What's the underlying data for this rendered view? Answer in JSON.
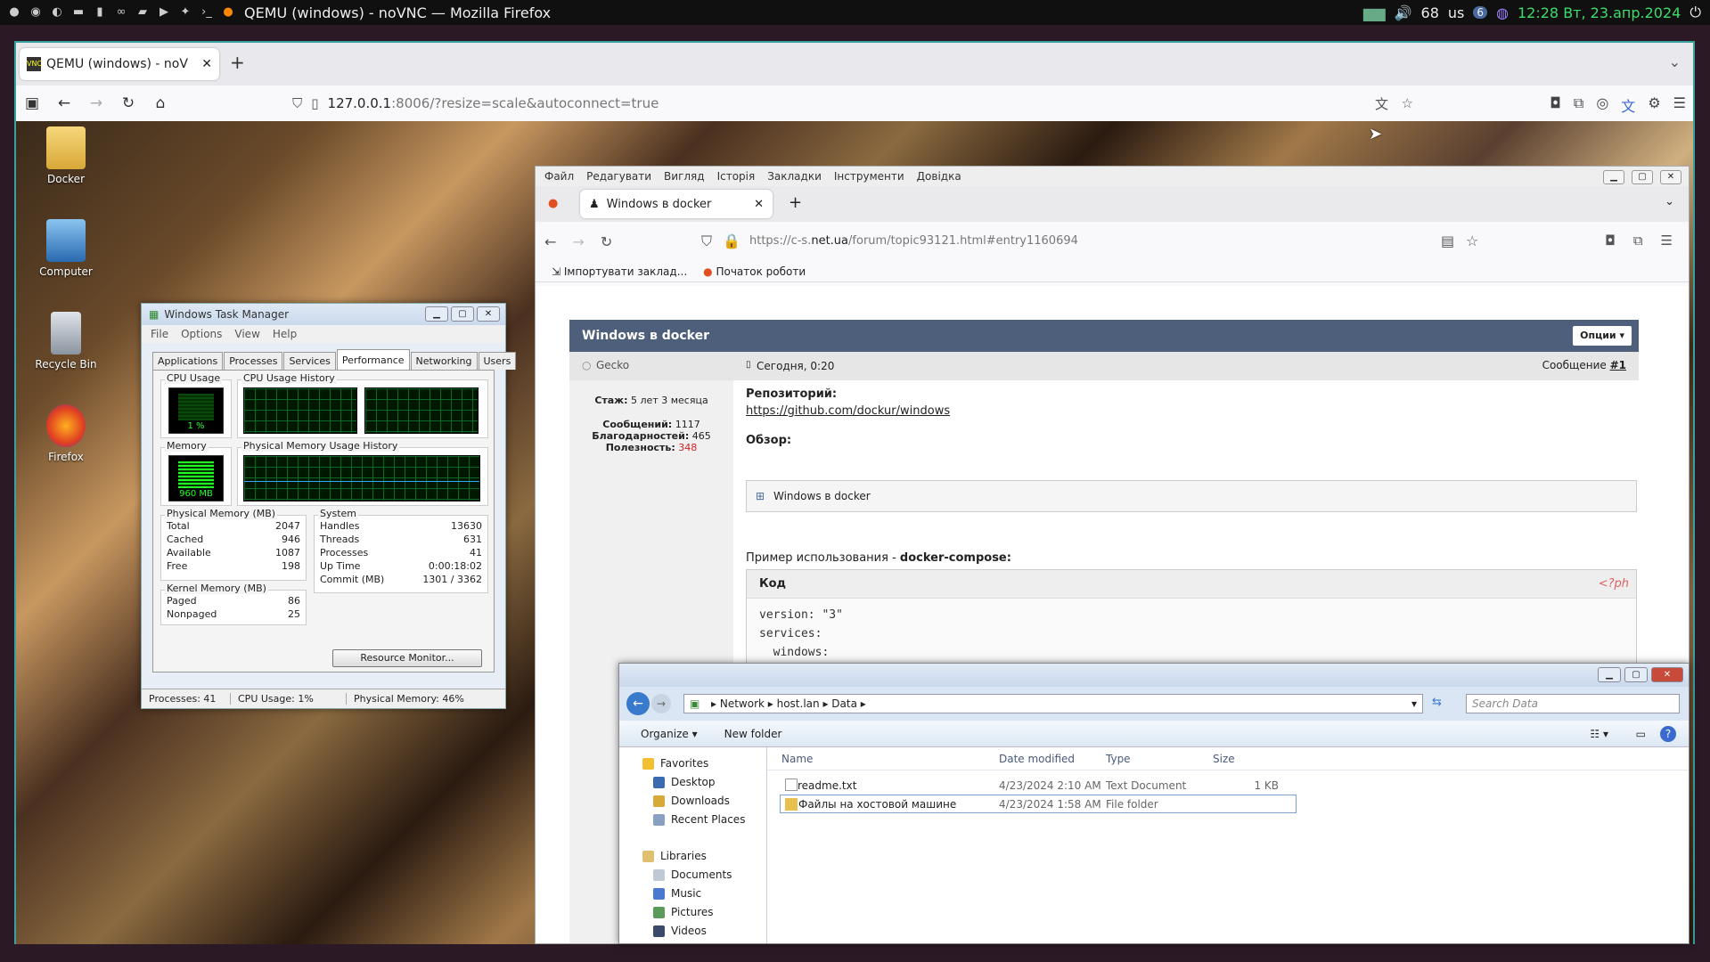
{
  "os_bar": {
    "window_title": "QEMU (windows) - noVNC — Mozilla Firefox",
    "volume": "68",
    "keyboard": "us",
    "badge": "6",
    "clock": "12:28 Вт, 23.апр.2024"
  },
  "outer_browser": {
    "tab_title": "QEMU (windows) - noVNC",
    "url_host": "127.0.0.1",
    "url_rest": ":8006/?resize=scale&autoconnect=true"
  },
  "desktop_icons": [
    "Docker",
    "Computer",
    "Recycle Bin",
    "Firefox"
  ],
  "task_manager": {
    "title": "Windows Task Manager",
    "menu": [
      "File",
      "Options",
      "View",
      "Help"
    ],
    "tabs": [
      "Applications",
      "Processes",
      "Services",
      "Performance",
      "Networking",
      "Users"
    ],
    "active_tab": "Performance",
    "cpu_usage_label": "CPU Usage",
    "cpu_value": "1 %",
    "cpu_history_label": "CPU Usage History",
    "memory_label": "Memory",
    "memory_value": "960 MB",
    "memory_history_label": "Physical Memory Usage History",
    "physical_memory": {
      "title": "Physical Memory (MB)",
      "rows": [
        [
          "Total",
          "2047"
        ],
        [
          "Cached",
          "946"
        ],
        [
          "Available",
          "1087"
        ],
        [
          "Free",
          "198"
        ]
      ]
    },
    "system": {
      "title": "System",
      "rows": [
        [
          "Handles",
          "13630"
        ],
        [
          "Threads",
          "631"
        ],
        [
          "Processes",
          "41"
        ],
        [
          "Up Time",
          "0:00:18:02"
        ],
        [
          "Commit (MB)",
          "1301 / 3362"
        ]
      ]
    },
    "kernel_memory": {
      "title": "Kernel Memory (MB)",
      "rows": [
        [
          "Paged",
          "86"
        ],
        [
          "Nonpaged",
          "25"
        ]
      ]
    },
    "resource_button": "Resource Monitor...",
    "status": [
      "Processes: 41",
      "CPU Usage: 1%",
      "Physical Memory: 46%"
    ]
  },
  "inner_browser": {
    "menu": [
      "Файл",
      "Редагувати",
      "Вигляд",
      "Історія",
      "Закладки",
      "Інструменти",
      "Довідка"
    ],
    "tab_title": "Windows в docker",
    "url_prefix": "https://c-s.",
    "url_host": "net.ua",
    "url_rest": "/forum/topic93121.html#entry1160694",
    "bookmarks": [
      "Імпортувати заклад...",
      "Початок роботи"
    ],
    "forum": {
      "topic_title": "Windows в docker",
      "options_button": "Опции ▾",
      "author": "Gecko",
      "date": "Сегодня, 0:20",
      "message_label": "Сообщение",
      "message_num": "#1",
      "stage_label": "Стаж:",
      "stage": "5 лет 3 месяца",
      "posts_label": "Сообщений:",
      "posts": "1117",
      "thanks_label": "Благодарностей:",
      "thanks": "465",
      "usefulness_label": "Полезность:",
      "usefulness": "348",
      "repo_label": "Репозиторий:",
      "repo_link": "https://github.com/dockur/windows",
      "overview_label": "Обзор:",
      "spoiler": "Windows в docker",
      "usage_text": "Пример использования - ",
      "usage_bold": "docker-compose:",
      "code_label": "Код",
      "code_tag": "<?ph",
      "code_lines": [
        "version: \"3\"",
        "services:",
        "  windows:"
      ]
    }
  },
  "explorer": {
    "path": [
      "Network",
      "host.lan",
      "Data"
    ],
    "search_placeholder": "Search Data",
    "toolbar": [
      "Organize ▾",
      "New folder"
    ],
    "nav": {
      "favorites": "Favorites",
      "fav_items": [
        "Desktop",
        "Downloads",
        "Recent Places"
      ],
      "libraries": "Libraries",
      "lib_items": [
        "Documents",
        "Music",
        "Pictures",
        "Videos"
      ]
    },
    "columns": [
      "Name",
      "Date modified",
      "Type",
      "Size"
    ],
    "files": [
      {
        "name": "readme.txt",
        "date": "4/23/2024 2:10 AM",
        "type": "Text Document",
        "size": "1 KB"
      },
      {
        "name": "Файлы на хостовой машине",
        "date": "4/23/2024 1:58 AM",
        "type": "File folder",
        "size": ""
      }
    ]
  },
  "colors": {
    "accent": "#3aa0a0",
    "forum_header": "#4d5f7a",
    "clock": "#3fdc6b",
    "usefulness": "#d02020"
  }
}
